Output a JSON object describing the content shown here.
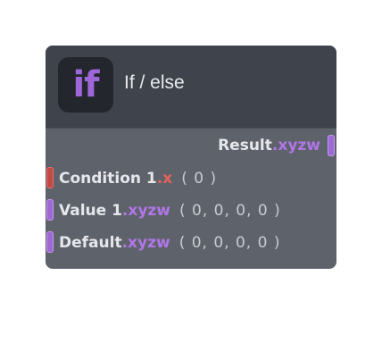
{
  "node": {
    "icon_text": "if",
    "title": "If / else",
    "output": {
      "label": "Result",
      "component": ".xyzw",
      "port_color": "#9d6ad4"
    },
    "inputs": [
      {
        "label": "Condition 1",
        "component": ".x",
        "default": "( 0 )",
        "port_color": "#c24a44"
      },
      {
        "label": "Value 1",
        "component": ".xyzw",
        "default": "( 0, 0, 0, 0 )",
        "port_color": "#9d6ad4"
      },
      {
        "label": "Default",
        "component": ".xyzw",
        "default": "( 0, 0, 0, 0 )",
        "port_color": "#9d6ad4"
      }
    ]
  },
  "colors": {
    "accent_purple": "#b176e8",
    "accent_red": "#e86059",
    "header_bg": "#3f434b",
    "body_bg": "#5e626b"
  }
}
